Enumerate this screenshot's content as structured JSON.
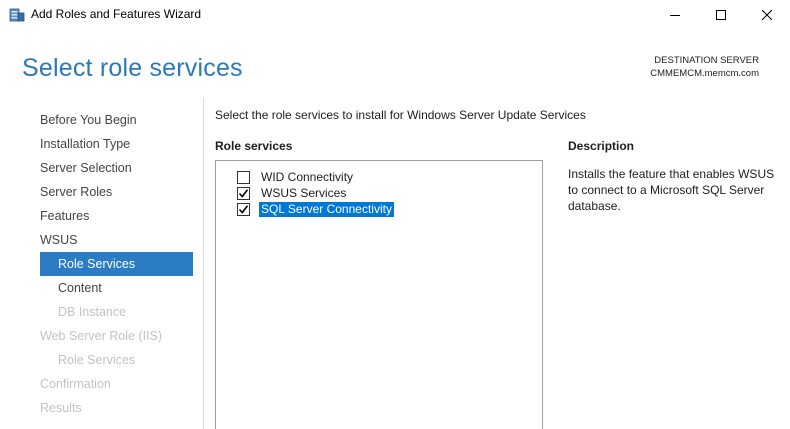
{
  "window": {
    "title": "Add Roles and Features Wizard",
    "app_icon": "server-manager-icon",
    "controls": [
      "minimize-icon",
      "maximize-icon",
      "close-icon"
    ]
  },
  "header": {
    "page_title": "Select role services",
    "destination_label": "DESTINATION SERVER",
    "destination_server": "CMMEMCM.memcm.com"
  },
  "nav": {
    "items": [
      {
        "label": "Before You Begin",
        "state": "normal"
      },
      {
        "label": "Installation Type",
        "state": "normal"
      },
      {
        "label": "Server Selection",
        "state": "normal"
      },
      {
        "label": "Server Roles",
        "state": "normal"
      },
      {
        "label": "Features",
        "state": "normal"
      },
      {
        "label": "WSUS",
        "state": "normal"
      },
      {
        "label": "Role Services",
        "state": "selected"
      },
      {
        "label": "Content",
        "state": "normal"
      },
      {
        "label": "DB Instance",
        "state": "disabled"
      },
      {
        "label": "Web Server Role (IIS)",
        "state": "disabled"
      },
      {
        "label": "Role Services",
        "state": "disabled"
      },
      {
        "label": "Confirmation",
        "state": "disabled"
      },
      {
        "label": "Results",
        "state": "disabled"
      }
    ]
  },
  "main": {
    "instruction": "Select the role services to install for Windows Server Update Services",
    "role_services_heading": "Role services",
    "description_heading": "Description",
    "role_services": [
      {
        "label": "WID Connectivity",
        "checked": false,
        "highlighted": false
      },
      {
        "label": "WSUS Services",
        "checked": true,
        "highlighted": false
      },
      {
        "label": "SQL Server Connectivity",
        "checked": true,
        "highlighted": true
      }
    ],
    "description": "Installs the feature that enables WSUS to connect to a Microsoft SQL Server database."
  },
  "colors": {
    "title_blue": "#2b7ab8",
    "nav_selected": "#2c7cc4",
    "list_highlight": "#0078d7",
    "disabled_text": "#c3c3c3"
  }
}
